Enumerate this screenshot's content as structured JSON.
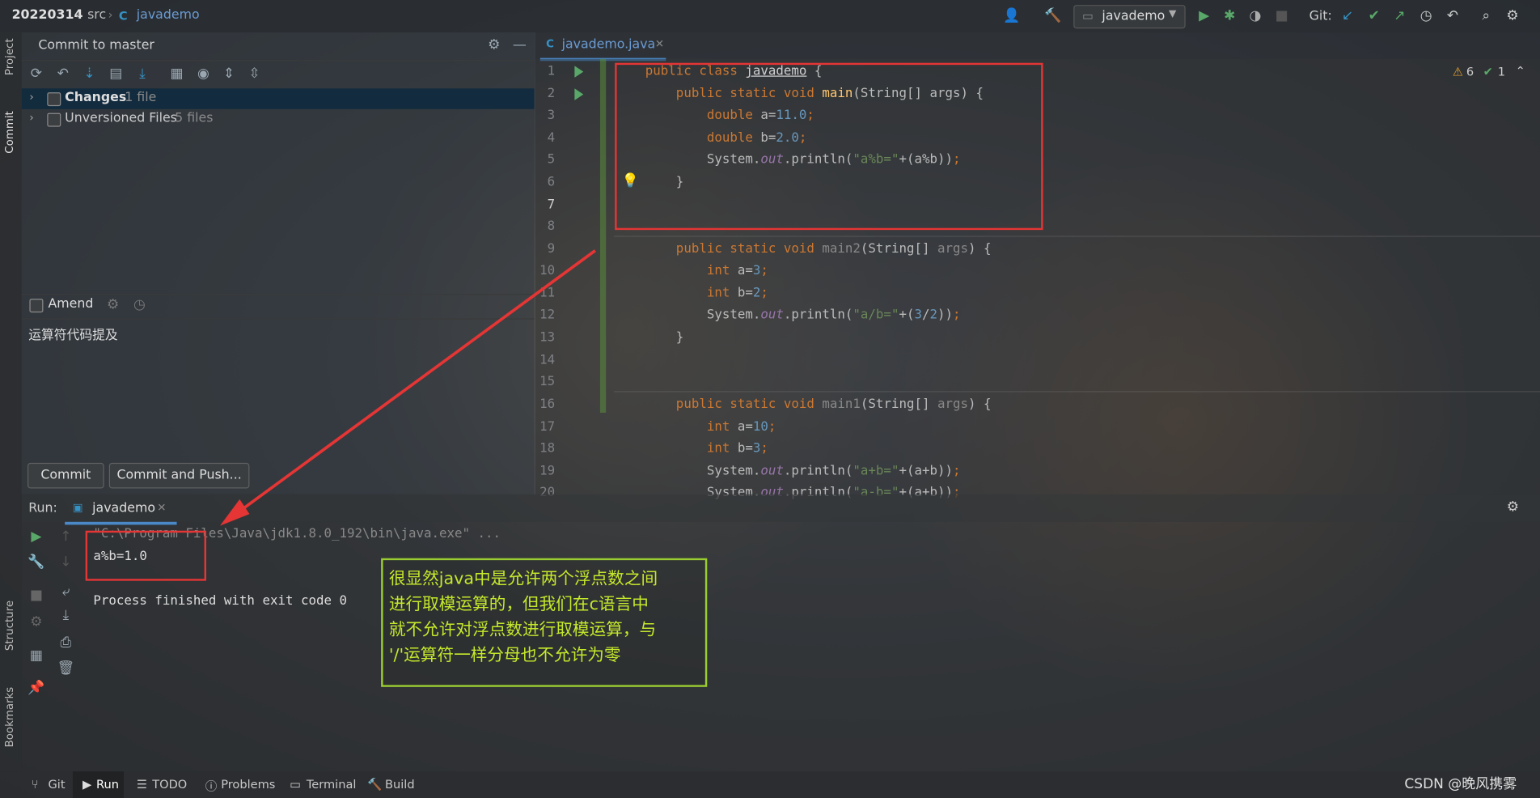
{
  "nav": {
    "project": "20220314",
    "src": "src",
    "file": "javademo",
    "run_config": "javademo",
    "git_label": "Git:"
  },
  "left_stripe": {
    "project": "Project",
    "commit": "Commit",
    "structure": "Structure",
    "bookmarks": "Bookmarks"
  },
  "commit_panel": {
    "title": "Commit to master",
    "changes_label": "Changes",
    "changes_count": "1 file",
    "unversioned_label": "Unversioned Files",
    "unversioned_count": "5 files",
    "amend_label": "Amend",
    "message": "运算符代码提及",
    "commit_button": "Commit",
    "commit_push_button": "Commit and Push..."
  },
  "editor": {
    "tab": "javademo.java",
    "warnings": "6",
    "weak_warnings": "1",
    "line_numbers": [
      "1",
      "2",
      "3",
      "4",
      "5",
      "6",
      "7",
      "8",
      "9",
      "10",
      "11",
      "12",
      "13",
      "14",
      "15",
      "16",
      "17",
      "18",
      "19",
      "20"
    ]
  },
  "run_panel": {
    "label": "Run:",
    "tab": "javademo",
    "cmd": "\"C:\\Program Files\\Java\\jdk1.8.0_192\\bin\\java.exe\" ...",
    "output": "a%b=1.0",
    "exit": "Process finished with exit code 0"
  },
  "note": {
    "line1": "很显然java中是允许两个浮点数之间",
    "line2": "进行取模运算的，但我们在c语言中",
    "line3": "就不允许对浮点数进行取模运算，与",
    "line4": "'/'运算符一样分母也不允许为零"
  },
  "bottom": {
    "git": "Git",
    "run": "Run",
    "todo": "TODO",
    "problems": "Problems",
    "terminal": "Terminal",
    "build": "Build"
  },
  "watermark": "CSDN @晚风携雾"
}
